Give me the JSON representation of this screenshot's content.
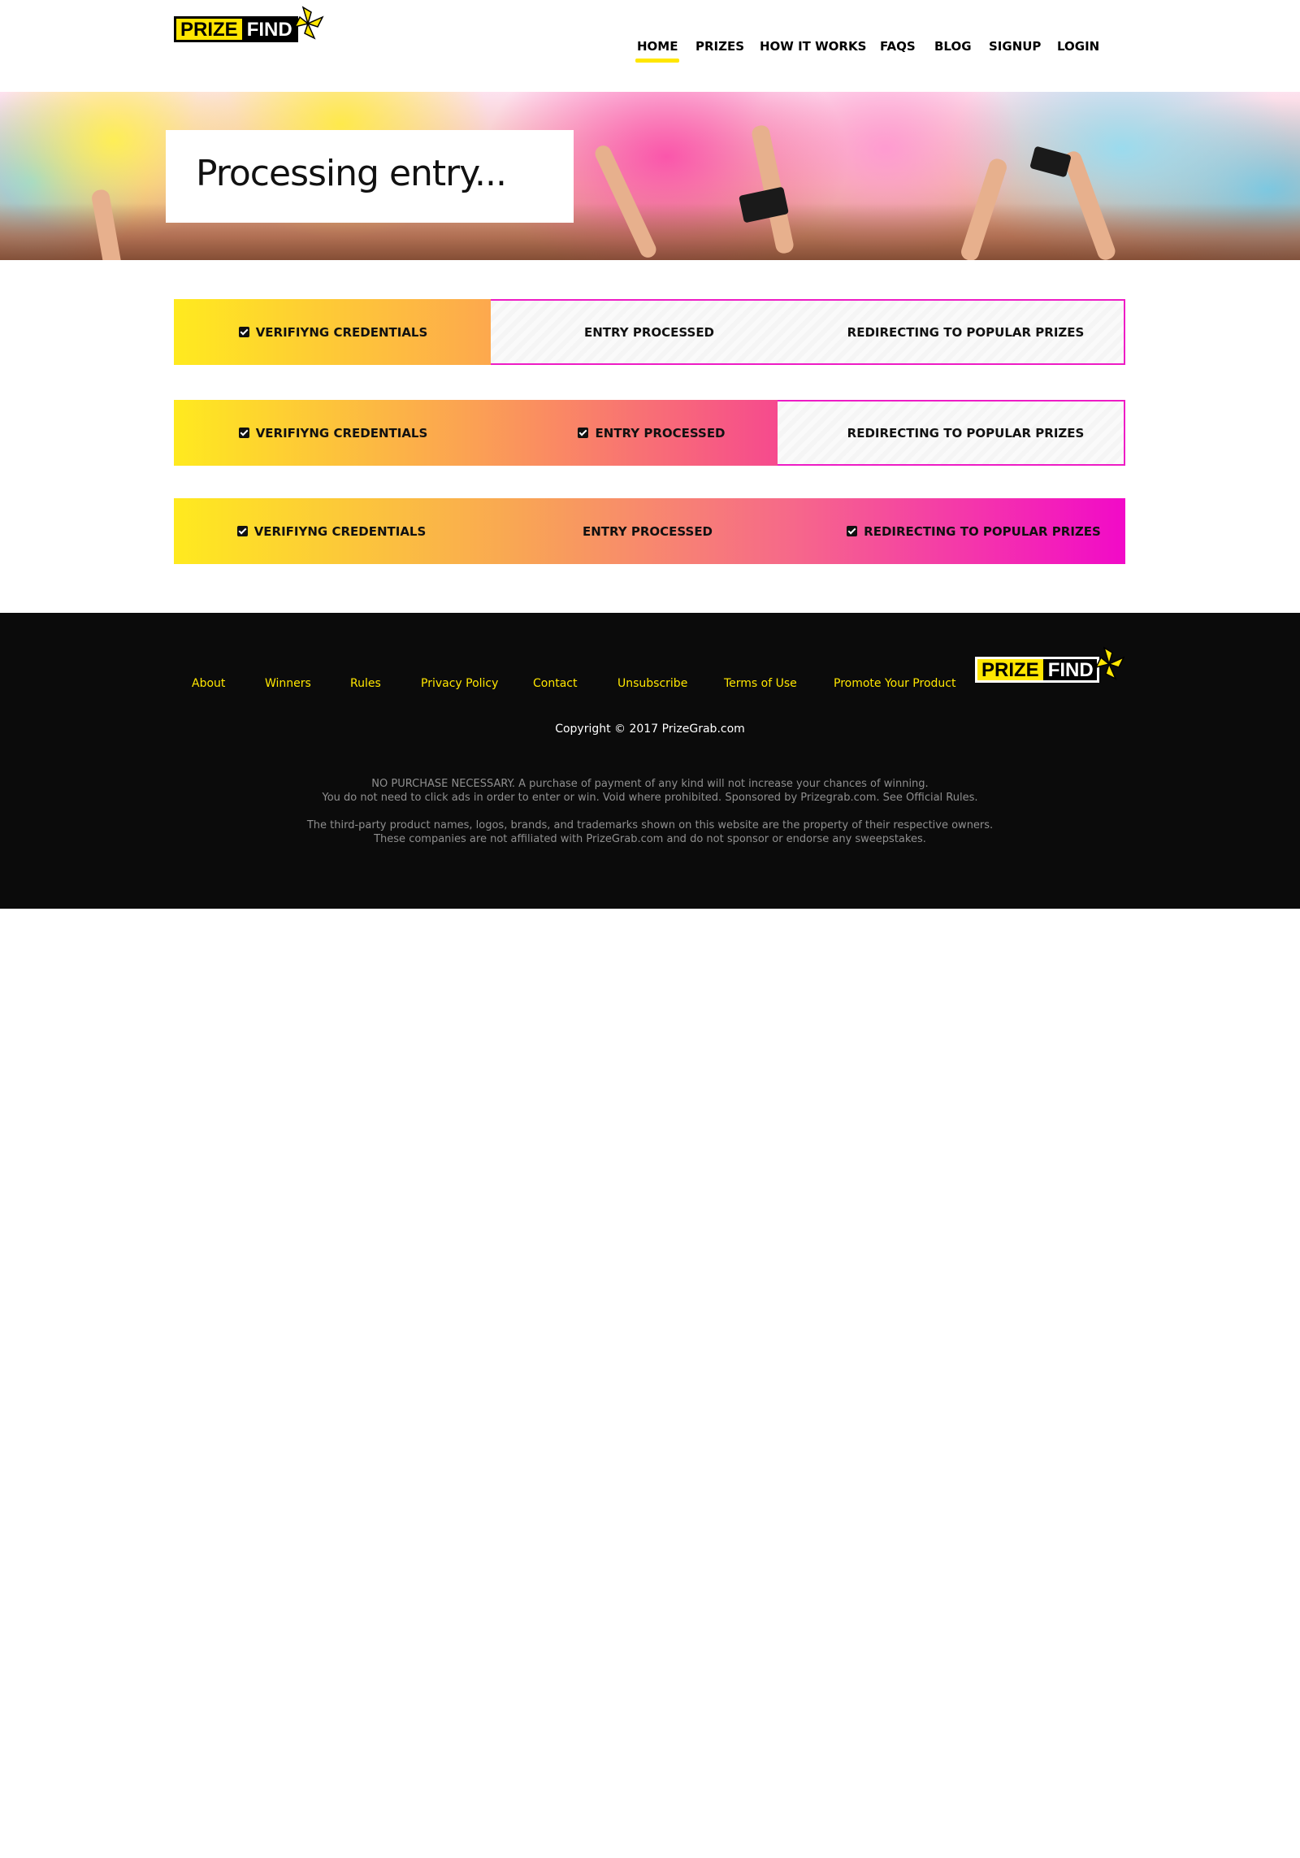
{
  "brand": {
    "prize": "PRIZE",
    "find": "FIND",
    "accent": "#ffe600"
  },
  "nav": {
    "items": [
      {
        "label": "HOME",
        "active": true
      },
      {
        "label": "PRIZES"
      },
      {
        "label": "HOW IT WORKS"
      },
      {
        "label": "FAQS"
      },
      {
        "label": "BLOG"
      },
      {
        "label": "SIGNUP"
      },
      {
        "label": "LOGIN"
      }
    ]
  },
  "hero": {
    "title": "Processing entry..."
  },
  "progress": [
    {
      "steps": [
        {
          "label": "VERIFIYNG CREDENTIALS",
          "checked": true
        },
        {
          "label": "ENTRY PROCESSED",
          "checked": false
        },
        {
          "label": "REDIRECTING TO POPULAR PRIZES",
          "checked": false
        }
      ]
    },
    {
      "steps": [
        {
          "label": "VERIFIYNG CREDENTIALS",
          "checked": true
        },
        {
          "label": "ENTRY PROCESSED",
          "checked": true
        },
        {
          "label": "REDIRECTING TO POPULAR PRIZES",
          "checked": false
        }
      ]
    },
    {
      "steps": [
        {
          "label": "VERIFIYNG CREDENTIALS",
          "checked": true
        },
        {
          "label": "ENTRY PROCESSED",
          "checked": false
        },
        {
          "label": "REDIRECTING TO POPULAR PRIZES",
          "checked": true
        }
      ]
    }
  ],
  "footer": {
    "links": [
      "About",
      "Winners",
      "Rules",
      "Privacy Policy",
      "Contact",
      "Unsubscribe",
      "Terms of Use",
      "Promote Your Product"
    ],
    "copyright": "Copyright © 2017 PrizeGrab.com",
    "legal1_line1": "NO PURCHASE NECESSARY. A purchase of payment of any kind will not increase your chances of winning.",
    "legal1_line2": "You do not need to click ads in order to enter or win. Void where prohibited. Sponsored by Prizegrab.com. See Official Rules.",
    "legal2_line1": "The third-party product names, logos, brands, and trademarks shown on this website are the property of their respective owners.",
    "legal2_line2": "These companies are not affiliated with PrizeGrab.com and do not sponsor or endorse any sweepstakes."
  }
}
